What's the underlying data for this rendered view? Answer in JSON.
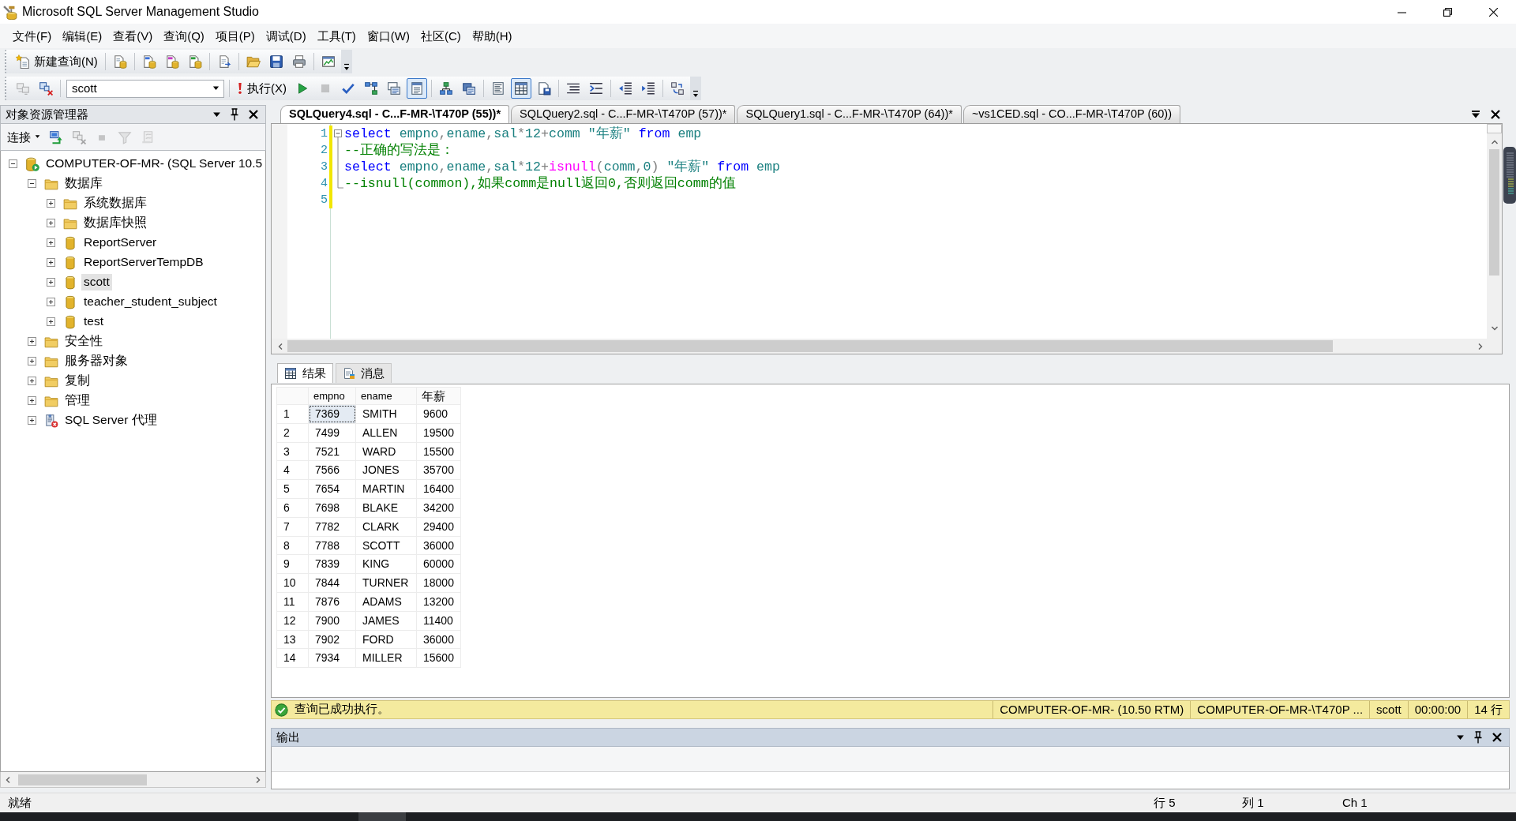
{
  "window": {
    "title": "Microsoft SQL Server Management Studio"
  },
  "menu": [
    "文件(F)",
    "编辑(E)",
    "查看(V)",
    "查询(Q)",
    "项目(P)",
    "调试(D)",
    "工具(T)",
    "窗口(W)",
    "社区(C)",
    "帮助(H)"
  ],
  "standard_toolbar": {
    "new_query": "新建查询(N)"
  },
  "query_toolbar": {
    "connect_buttons": [
      {
        "disabled": true
      },
      {
        "disabled": false
      }
    ],
    "database": "scott",
    "execute": "执行(X)",
    "buttons": [
      {
        "disabled": false,
        "pressed": false
      },
      {
        "disabled": true,
        "pressed": false
      },
      {
        "disabled": false,
        "pressed": false
      },
      {
        "disabled": false,
        "pressed": false
      },
      {
        "disabled": false,
        "pressed": false
      },
      {
        "disabled": false,
        "pressed": true
      },
      {
        "disabled": false,
        "pressed": false
      },
      {
        "disabled": false,
        "pressed": false
      },
      {
        "disabled": false,
        "pressed": false
      },
      {
        "disabled": false,
        "pressed": true
      },
      {
        "disabled": false,
        "pressed": false
      },
      {
        "disabled": false,
        "pressed": false
      },
      {
        "disabled": false,
        "pressed": false
      },
      {
        "disabled": false,
        "pressed": false
      },
      {
        "disabled": false,
        "pressed": false
      },
      {
        "disabled": false,
        "pressed": false
      }
    ]
  },
  "object_explorer": {
    "title": "对象资源管理器",
    "connect": "连接",
    "buttons": [
      {
        "disabled": false
      },
      {
        "disabled": true
      },
      {
        "disabled": true
      },
      {
        "disabled": true
      },
      {
        "disabled": true
      }
    ],
    "tree": [
      {
        "label": "COMPUTER-OF-MR- (SQL Server 10.5",
        "kind": "server",
        "expanded": true,
        "selected": false,
        "children": [
          {
            "label": "数据库",
            "kind": "folder",
            "expanded": true,
            "selected": false,
            "children": [
              {
                "label": "系统数据库",
                "kind": "folder",
                "expanded": false,
                "selected": false
              },
              {
                "label": "数据库快照",
                "kind": "folder",
                "expanded": false,
                "selected": false
              },
              {
                "label": "ReportServer",
                "kind": "database",
                "expanded": false,
                "selected": false
              },
              {
                "label": "ReportServerTempDB",
                "kind": "database",
                "expanded": false,
                "selected": false
              },
              {
                "label": "scott",
                "kind": "database",
                "expanded": false,
                "selected": true
              },
              {
                "label": "teacher_student_subject",
                "kind": "database",
                "expanded": false,
                "selected": false
              },
              {
                "label": "test",
                "kind": "database",
                "expanded": false,
                "selected": false
              }
            ]
          },
          {
            "label": "安全性",
            "kind": "folder",
            "expanded": false,
            "selected": false
          },
          {
            "label": "服务器对象",
            "kind": "folder",
            "expanded": false,
            "selected": false
          },
          {
            "label": "复制",
            "kind": "folder",
            "expanded": false,
            "selected": false
          },
          {
            "label": "管理",
            "kind": "folder",
            "expanded": false,
            "selected": false
          },
          {
            "label": "SQL Server 代理",
            "kind": "agent",
            "expanded": false,
            "selected": false
          }
        ]
      }
    ]
  },
  "editor": {
    "tabs": [
      {
        "label": "SQLQuery4.sql - C...F-MR-\\T470P (55))*",
        "selected": true
      },
      {
        "label": "SQLQuery2.sql - C...F-MR-\\T470P (57))*",
        "selected": false
      },
      {
        "label": "SQLQuery1.sql - C...F-MR-\\T470P (64))*",
        "selected": false
      },
      {
        "label": "~vs1CED.sql - CO...F-MR-\\T470P (60))",
        "selected": false
      }
    ],
    "fold_expanded": true,
    "lines": [
      {
        "number": "1",
        "modified": true,
        "in_fold": true,
        "tokens": [
          {
            "kind": "keyword",
            "text": "select"
          },
          {
            "kind": "identifier",
            "text": " empno"
          },
          {
            "kind": "operator",
            "text": ","
          },
          {
            "kind": "identifier",
            "text": "ename"
          },
          {
            "kind": "operator",
            "text": ","
          },
          {
            "kind": "identifier",
            "text": "sal"
          },
          {
            "kind": "operator",
            "text": "*"
          },
          {
            "kind": "identifier",
            "text": "12"
          },
          {
            "kind": "operator",
            "text": "+"
          },
          {
            "kind": "identifier",
            "text": "comm \"年薪\" "
          },
          {
            "kind": "keyword",
            "text": "from"
          },
          {
            "kind": "identifier",
            "text": " emp"
          }
        ]
      },
      {
        "number": "2",
        "modified": true,
        "in_fold": true,
        "tokens": [
          {
            "kind": "comment",
            "text": "--正确的写法是："
          }
        ]
      },
      {
        "number": "3",
        "modified": true,
        "in_fold": true,
        "tokens": [
          {
            "kind": "keyword",
            "text": "select"
          },
          {
            "kind": "identifier",
            "text": " empno"
          },
          {
            "kind": "operator",
            "text": ","
          },
          {
            "kind": "identifier",
            "text": "ename"
          },
          {
            "kind": "operator",
            "text": ","
          },
          {
            "kind": "identifier",
            "text": "sal"
          },
          {
            "kind": "operator",
            "text": "*"
          },
          {
            "kind": "identifier",
            "text": "12"
          },
          {
            "kind": "operator",
            "text": "+"
          },
          {
            "kind": "function",
            "text": "isnull"
          },
          {
            "kind": "operator",
            "text": "("
          },
          {
            "kind": "identifier",
            "text": "comm"
          },
          {
            "kind": "operator",
            "text": ","
          },
          {
            "kind": "identifier",
            "text": "0"
          },
          {
            "kind": "operator",
            "text": ")"
          },
          {
            "kind": "identifier",
            "text": " \"年薪\" "
          },
          {
            "kind": "keyword",
            "text": "from"
          },
          {
            "kind": "identifier",
            "text": " emp"
          }
        ]
      },
      {
        "number": "4",
        "modified": true,
        "in_fold": true,
        "tokens": [
          {
            "kind": "comment",
            "text": "--isnull(common),如果comm是null返回0,否则返回comm的值"
          }
        ]
      },
      {
        "number": "5",
        "modified": true
      }
    ]
  },
  "results": {
    "tabs": [
      {
        "label": "结果",
        "selected": true
      },
      {
        "label": "消息",
        "selected": false
      }
    ],
    "columns": [
      "empno",
      "ename",
      "年薪"
    ],
    "rows": [
      {
        "number": "1",
        "cells": [
          {
            "text": "7369",
            "selected": true
          },
          {
            "text": "SMITH",
            "selected": false
          },
          {
            "text": "9600",
            "selected": false
          }
        ]
      },
      {
        "number": "2",
        "cells": [
          {
            "text": "7499",
            "selected": false
          },
          {
            "text": "ALLEN",
            "selected": false
          },
          {
            "text": "19500",
            "selected": false
          }
        ]
      },
      {
        "number": "3",
        "cells": [
          {
            "text": "7521",
            "selected": false
          },
          {
            "text": "WARD",
            "selected": false
          },
          {
            "text": "15500",
            "selected": false
          }
        ]
      },
      {
        "number": "4",
        "cells": [
          {
            "text": "7566",
            "selected": false
          },
          {
            "text": "JONES",
            "selected": false
          },
          {
            "text": "35700",
            "selected": false
          }
        ]
      },
      {
        "number": "5",
        "cells": [
          {
            "text": "7654",
            "selected": false
          },
          {
            "text": "MARTIN",
            "selected": false
          },
          {
            "text": "16400",
            "selected": false
          }
        ]
      },
      {
        "number": "6",
        "cells": [
          {
            "text": "7698",
            "selected": false
          },
          {
            "text": "BLAKE",
            "selected": false
          },
          {
            "text": "34200",
            "selected": false
          }
        ]
      },
      {
        "number": "7",
        "cells": [
          {
            "text": "7782",
            "selected": false
          },
          {
            "text": "CLARK",
            "selected": false
          },
          {
            "text": "29400",
            "selected": false
          }
        ]
      },
      {
        "number": "8",
        "cells": [
          {
            "text": "7788",
            "selected": false
          },
          {
            "text": "SCOTT",
            "selected": false
          },
          {
            "text": "36000",
            "selected": false
          }
        ]
      },
      {
        "number": "9",
        "cells": [
          {
            "text": "7839",
            "selected": false
          },
          {
            "text": "KING",
            "selected": false
          },
          {
            "text": "60000",
            "selected": false
          }
        ]
      },
      {
        "number": "10",
        "cells": [
          {
            "text": "7844",
            "selected": false
          },
          {
            "text": "TURNER",
            "selected": false
          },
          {
            "text": "18000",
            "selected": false
          }
        ]
      },
      {
        "number": "11",
        "cells": [
          {
            "text": "7876",
            "selected": false
          },
          {
            "text": "ADAMS",
            "selected": false
          },
          {
            "text": "13200",
            "selected": false
          }
        ]
      },
      {
        "number": "12",
        "cells": [
          {
            "text": "7900",
            "selected": false
          },
          {
            "text": "JAMES",
            "selected": false
          },
          {
            "text": "11400",
            "selected": false
          }
        ]
      },
      {
        "number": "13",
        "cells": [
          {
            "text": "7902",
            "selected": false
          },
          {
            "text": "FORD",
            "selected": false
          },
          {
            "text": "36000",
            "selected": false
          }
        ]
      },
      {
        "number": "14",
        "cells": [
          {
            "text": "7934",
            "selected": false
          },
          {
            "text": "MILLER",
            "selected": false
          },
          {
            "text": "15600",
            "selected": false
          }
        ]
      }
    ]
  },
  "query_status": {
    "kind": "success",
    "message": "查询已成功执行。",
    "fields": [
      "COMPUTER-OF-MR- (10.50 RTM)",
      "COMPUTER-OF-MR-\\T470P ...",
      "scott",
      "00:00:00",
      "14 行"
    ]
  },
  "output": {
    "title": "输出"
  },
  "status_bar": {
    "text": "就绪",
    "line": "行 5",
    "column": "列 1",
    "char": "Ch 1"
  }
}
